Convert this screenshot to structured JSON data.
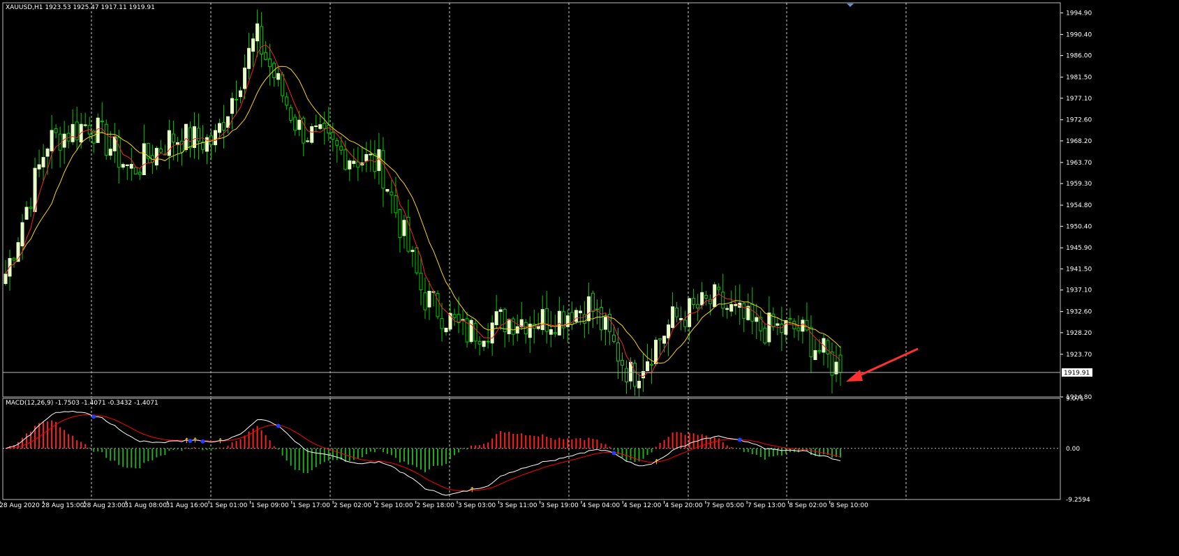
{
  "main_chart": {
    "symbol_label": "XAUUSD,H1  1923.53 1925.47 1917.11 1919.91",
    "current_price": "1919.91",
    "price_axis_labels": [
      "1994.90",
      "1990.40",
      "1986.00",
      "1981.50",
      "1977.10",
      "1972.60",
      "1968.20",
      "1963.70",
      "1959.30",
      "1954.80",
      "1950.40",
      "1945.90",
      "1941.50",
      "1937.10",
      "1932.60",
      "1928.20",
      "1923.70",
      "1914.80"
    ],
    "time_axis_labels": [
      "28 Aug 2020",
      "28 Aug 15:00",
      "28 Aug 23:00",
      "31 Aug 08:00",
      "31 Aug 16:00",
      "1 Sep 01:00",
      "1 Sep 09:00",
      "1 Sep 17:00",
      "2 Sep 02:00",
      "2 Sep 10:00",
      "2 Sep 18:00",
      "3 Sep 03:00",
      "3 Sep 11:00",
      "3 Sep 19:00",
      "4 Sep 04:00",
      "4 Sep 12:00",
      "4 Sep 20:00",
      "7 Sep 05:00",
      "7 Sep 13:00",
      "8 Sep 02:00",
      "8 Sep 10:00"
    ]
  },
  "macd": {
    "label": "MACD(12,26,9) -1.7503 -1.4071 -0.3432 -1.4071",
    "axis_labels": [
      "9.071",
      "0.00",
      "-9.2594"
    ]
  },
  "colors": {
    "bull_candle": "#e8ffc8",
    "bear_candle": "#000000",
    "wick": "#00cc00",
    "fast_ma": "#ff2020",
    "slow_ma": "#ffd700",
    "macd_line": "#ffffff",
    "signal_line": "#ff0000",
    "hist_pos": "#ff2020",
    "hist_neg": "#22aa22",
    "arrow": "#ff3030",
    "grid": "#ffffff"
  },
  "chart_data": {
    "type": "candlestick",
    "x": [
      "28 Aug 2020",
      "28 Aug 15:00",
      "28 Aug 23:00",
      "31 Aug 08:00",
      "31 Aug 16:00",
      "1 Sep 01:00",
      "1 Sep 09:00",
      "1 Sep 17:00",
      "2 Sep 02:00",
      "2 Sep 10:00",
      "2 Sep 18:00",
      "3 Sep 03:00",
      "3 Sep 11:00",
      "3 Sep 19:00",
      "4 Sep 04:00",
      "4 Sep 12:00",
      "4 Sep 20:00",
      "7 Sep 05:00",
      "7 Sep 13:00",
      "8 Sep 02:00",
      "8 Sep 10:00"
    ],
    "close": [
      1940.5,
      1968.0,
      1972.0,
      1962.0,
      1969.0,
      1968.0,
      1990.0,
      1971.0,
      1966.0,
      1963.0,
      1936.0,
      1928.0,
      1931.0,
      1931.0,
      1934.0,
      1919.0,
      1931.0,
      1935.0,
      1929.0,
      1929.0,
      1919.91
    ],
    "last_bar": {
      "open": 1923.53,
      "high": 1925.47,
      "low": 1917.11,
      "close": 1919.91
    },
    "price_range": [
      1914.8,
      1997.0
    ],
    "macd_range": [
      -9.2594,
      9.071
    ],
    "series": [
      {
        "name": "MACD(12,26,9)",
        "values": [
          2.0,
          6.5,
          8.5,
          5.5,
          2.0,
          2.0,
          7.5,
          -0.5,
          -2.5,
          -3.5,
          -8.0,
          -7.0,
          -6.0,
          -5.0,
          -3.0,
          -0.5,
          -1.5,
          -0.5,
          -1.0,
          -1.5,
          -1.4071
        ]
      }
    ],
    "grid": true
  }
}
